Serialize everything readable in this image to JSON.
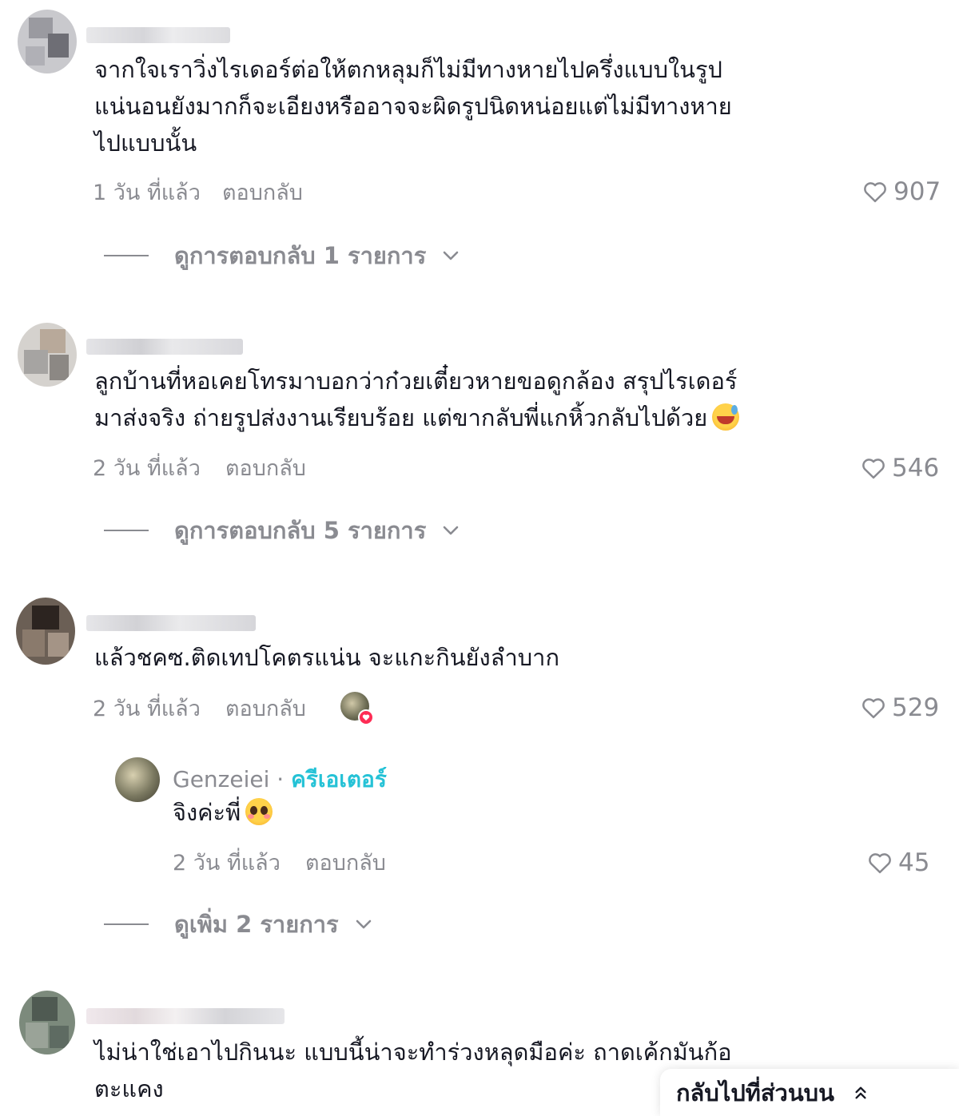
{
  "comments": [
    {
      "text_lines": [
        "จากใจเราวิ่งไรเดอร์ต่อให้ตกหลุมก็ไม่มีทางหายไปครึ่งแบบในรูป",
        "แน่นอนยังมากก็จะเอียงหรืออาจจะผิดรูปนิดหน่อยแต่ไม่มีทางหาย",
        "ไปแบบนั้น"
      ],
      "time": "1 วัน ที่แล้ว",
      "reply": "ตอบกลับ",
      "likes": "907",
      "view_replies": "ดูการตอบกลับ 1 รายการ"
    },
    {
      "text_lines": [
        "ลูกบ้านที่หอเคยโทรมาบอกว่าก๋วยเตี๋ยวหายขอดูกล้อง สรุปไรเดอร์",
        "มาส่งจริง ถ่ายรูปส่งงานเรียบร้อย แต่ขากลับพี่แกหิ้วกลับไปด้วย"
      ],
      "emoji": "sweat-smile-emoji",
      "time": "2 วัน ที่แล้ว",
      "reply": "ตอบกลับ",
      "likes": "546",
      "view_replies": "ดูการตอบกลับ 5 รายการ"
    },
    {
      "text_lines": [
        "แล้วชคซ.ติดเทปโคตรแน่น จะแกะกินยังลำบาก"
      ],
      "time": "2 วัน ที่แล้ว",
      "reply": "ตอบกลับ",
      "likes": "529",
      "creator_liked": true,
      "creator_reply": {
        "name": "Genzeiei",
        "separator": "·",
        "badge": "ครีเอเตอร์",
        "text": "จิงค่ะพี่",
        "emoji": "pleading-face-emoji",
        "time": "2 วัน ที่แล้ว",
        "reply": "ตอบกลับ",
        "likes": "45"
      },
      "view_more": "ดูเพิ่ม 2 รายการ"
    },
    {
      "text_lines": [
        "ไม่น่าใช่เอาไปกินนะ แบบนี้น่าจะทำร่วงหลุดมือค่ะ ถาดเค้กมันก้อ",
        "ตะแคง"
      ]
    }
  ],
  "back_to_top": "กลับไปที่ส่วนบน",
  "icons": {
    "like": "heart-outline-icon",
    "expand": "chevron-down-icon",
    "back_to_top": "double-chevron-up-icon"
  },
  "colors": {
    "text": "#161823",
    "meta": "#8a8b91",
    "creator_badge": "#25c2d6",
    "creator_like_badge": "#fe2c55"
  }
}
